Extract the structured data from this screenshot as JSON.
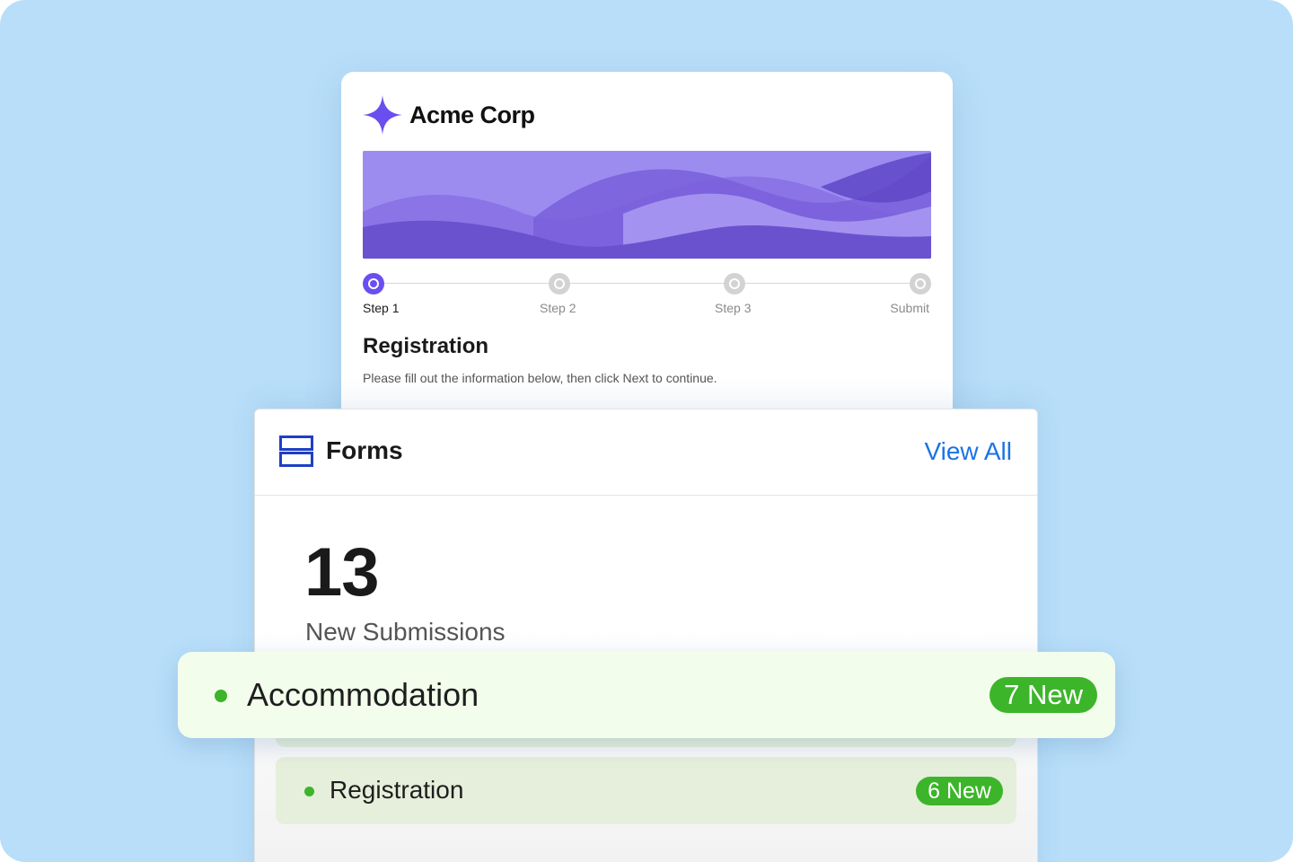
{
  "form": {
    "brand_name": "Acme Corp",
    "brand_icon": "sparkle-icon",
    "steps": [
      {
        "label": "Step 1",
        "active": true
      },
      {
        "label": "Step 2",
        "active": false
      },
      {
        "label": "Step 3",
        "active": false
      },
      {
        "label": "Submit",
        "active": false
      }
    ],
    "title": "Registration",
    "description": "Please fill out the information below, then click Next to continue."
  },
  "forms_panel": {
    "icon": "forms-list-icon",
    "title": "Forms",
    "view_all": "View All",
    "count": "13",
    "count_label": "New Submissions"
  },
  "items": [
    {
      "name": "Accommodation",
      "badge": "7 New"
    },
    {
      "name": "Registration",
      "badge": "6 New"
    }
  ],
  "colors": {
    "background": "#b8def9",
    "accent_purple": "#6b4ef0",
    "link_blue": "#1a73e8",
    "status_green": "#3cb52a",
    "forms_icon_blue": "#1f3fc4"
  }
}
